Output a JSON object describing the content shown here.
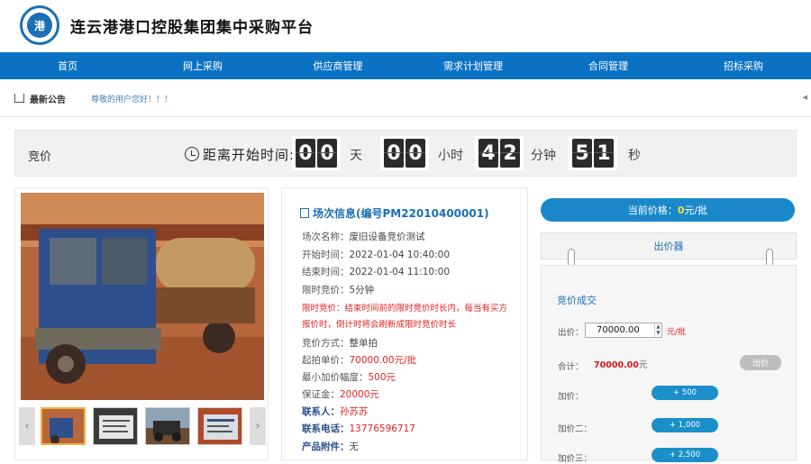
{
  "header": {
    "logo_icon": "port-group-logo",
    "title": "连云港港口控股集团集中采购平台"
  },
  "nav": {
    "items": [
      "首页",
      "网上采购",
      "供应商管理",
      "需求计划管理",
      "合同管理",
      "招标采购"
    ]
  },
  "notice": {
    "title": "最新公告",
    "text": "尊敬的用户您好！！！"
  },
  "bid_bar": {
    "label": "竞价",
    "countdown_label": "距离开始时间:",
    "days": [
      "0",
      "0"
    ],
    "hours": [
      "0",
      "0"
    ],
    "minutes": [
      "4",
      "2"
    ],
    "seconds": [
      "5",
      "1"
    ],
    "units": {
      "days": "天",
      "hours": "小时",
      "minutes": "分钟",
      "seconds": "秒"
    }
  },
  "info": {
    "title": "场次信息(编号PM22010400001)",
    "rows": [
      {
        "k": "场次名称：",
        "v": "废旧设备竞价测试"
      },
      {
        "k": "开始时间：",
        "v": "2022-01-04 10:40:00"
      },
      {
        "k": "结束时间：",
        "v": "2022-01-04 11:10:00"
      },
      {
        "k": "限时竞价：",
        "v": "5分钟"
      },
      {
        "k": "限时竞价：",
        "v": "结束时间前的限时竞价时长内，每当有买方"
      },
      {
        "k": "",
        "v": "报价时，倒计时将会刷新成限时竞价时长"
      },
      {
        "k": "竞价方式：",
        "v": "整单拍"
      },
      {
        "k": "起拍单价：",
        "v": "70000.00元/批"
      },
      {
        "k": "最小加价幅度：",
        "v": "500元"
      },
      {
        "k": "保证金：",
        "v": "20000元"
      },
      {
        "k": "联系人：",
        "v": "孙苏苏"
      },
      {
        "k": "联系电话：",
        "v": "13776596717"
      },
      {
        "k": "产品附件：",
        "v": "无"
      }
    ]
  },
  "price": {
    "current_label": "当前价格：",
    "current_value": "0",
    "current_unit": "元/批",
    "tab": "出价器",
    "box_title": "竞价成交",
    "bid_label": "出价：",
    "bid_value": "70000.00",
    "bid_unit": "元/批",
    "total_label": "合计：",
    "total_value": "70000.00",
    "total_unit": "元",
    "submit": "出价",
    "add_rows": [
      {
        "label": "加价：",
        "btn": "+ 500"
      },
      {
        "label": "加价二：",
        "btn": "+ 1,000"
      },
      {
        "label": "加价三：",
        "btn": "+ 2,500"
      }
    ]
  },
  "colors": {
    "nav": "#0b72c3",
    "accent": "#1a88c9",
    "warning": "#e02222"
  }
}
